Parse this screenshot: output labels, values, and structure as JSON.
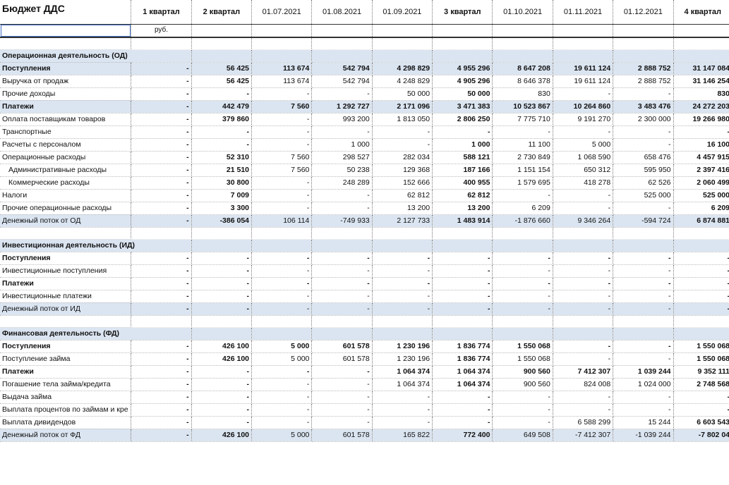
{
  "sheet": {
    "title": "Бюджет ДДС",
    "unit": "руб.",
    "columns": [
      "1 квартал",
      "2 квартал",
      "01.07.2021",
      "01.08.2021",
      "01.09.2021",
      "3 квартал",
      "01.10.2021",
      "01.11.2021",
      "01.12.2021",
      "4 квартал"
    ],
    "bold_columns": [
      0,
      1,
      5,
      9
    ]
  },
  "rows": [
    {
      "type": "blank"
    },
    {
      "type": "section",
      "label": "Операционная деятельность (ОД)"
    },
    {
      "type": "subtotal",
      "label": "Поступления",
      "values": [
        "-",
        "56 425",
        "113 674",
        "542 794",
        "4 298 829",
        "4 955 296",
        "8 647 208",
        "19 611 124",
        "2 888 752",
        "31 147 084"
      ]
    },
    {
      "type": "row",
      "label": "Выручка от продаж",
      "values": [
        "-",
        "56 425",
        "113 674",
        "542 794",
        "4 248 829",
        "4 905 296",
        "8 646 378",
        "19 611 124",
        "2 888 752",
        "31 146 254"
      ]
    },
    {
      "type": "row",
      "label": "Прочие доходы",
      "values": [
        "-",
        "-",
        "-",
        "-",
        "50 000",
        "50 000",
        "830",
        "-",
        "-",
        "830"
      ]
    },
    {
      "type": "subtotal",
      "label": "Платежи",
      "values": [
        "-",
        "442 479",
        "7 560",
        "1 292 727",
        "2 171 096",
        "3 471 383",
        "10 523 867",
        "10 264 860",
        "3 483 476",
        "24 272 203"
      ]
    },
    {
      "type": "row",
      "label": "Оплата поставщикам товаров",
      "values": [
        "-",
        "379 860",
        "-",
        "993 200",
        "1 813 050",
        "2 806 250",
        "7 775 710",
        "9 191 270",
        "2 300 000",
        "19 266 980"
      ]
    },
    {
      "type": "row",
      "label": "Транспортные",
      "values": [
        "-",
        "-",
        "-",
        "-",
        "-",
        "-",
        "-",
        "-",
        "-",
        "-"
      ]
    },
    {
      "type": "row",
      "label": "Расчеты с персоналом",
      "values": [
        "-",
        "-",
        "-",
        "1 000",
        "-",
        "1 000",
        "11 100",
        "5 000",
        "-",
        "16 100"
      ]
    },
    {
      "type": "row",
      "label": "Операционные расходы",
      "values": [
        "-",
        "52 310",
        "7 560",
        "298 527",
        "282 034",
        "588 121",
        "2 730 849",
        "1 068 590",
        "658 476",
        "4 457 915"
      ]
    },
    {
      "type": "row",
      "indent": true,
      "label": "Административные расходы",
      "values": [
        "-",
        "21 510",
        "7 560",
        "50 238",
        "129 368",
        "187 166",
        "1 151 154",
        "650 312",
        "595 950",
        "2 397 416"
      ]
    },
    {
      "type": "row",
      "indent": true,
      "label": "Коммерческие расходы",
      "values": [
        "-",
        "30 800",
        "-",
        "248 289",
        "152 666",
        "400 955",
        "1 579 695",
        "418 278",
        "62 526",
        "2 060 499"
      ]
    },
    {
      "type": "row",
      "label": "Налоги",
      "values": [
        "-",
        "7 009",
        "-",
        "-",
        "62 812",
        "62 812",
        "-",
        "-",
        "525 000",
        "525 000"
      ]
    },
    {
      "type": "row",
      "label": "Прочие операционные расходы",
      "values": [
        "-",
        "3 300",
        "-",
        "-",
        "13 200",
        "13 200",
        "6 209",
        "-",
        "-",
        "6 209"
      ]
    },
    {
      "type": "total",
      "label": "Денежный поток от ОД",
      "values": [
        "-",
        "-386 054",
        "106 114",
        "-749 933",
        "2 127 733",
        "1 483 914",
        "-1 876 660",
        "9 346 264",
        "-594 724",
        "6 874 881"
      ]
    },
    {
      "type": "blank"
    },
    {
      "type": "section",
      "label": "Инвестиционная деятельность (ИД)"
    },
    {
      "type": "bold",
      "label": "Поступления",
      "values": [
        "-",
        "-",
        "-",
        "-",
        "-",
        "-",
        "-",
        "-",
        "-",
        "-"
      ]
    },
    {
      "type": "row",
      "label": "Инвестиционные поступления",
      "values": [
        "-",
        "-",
        "-",
        "-",
        "-",
        "-",
        "-",
        "-",
        "-",
        "-"
      ]
    },
    {
      "type": "bold",
      "label": "Платежи",
      "values": [
        "-",
        "-",
        "-",
        "-",
        "-",
        "-",
        "-",
        "-",
        "-",
        "-"
      ]
    },
    {
      "type": "row",
      "label": "Инвестиционные платежи",
      "values": [
        "-",
        "-",
        "-",
        "-",
        "-",
        "-",
        "-",
        "-",
        "-",
        "-"
      ]
    },
    {
      "type": "total",
      "label": "Денежный поток от ИД",
      "values": [
        "-",
        "-",
        "-",
        "-",
        "-",
        "-",
        "-",
        "-",
        "-",
        "-"
      ]
    },
    {
      "type": "blank"
    },
    {
      "type": "section",
      "label": "Финансовая деятельность (ФД)"
    },
    {
      "type": "bold",
      "label": "Поступления",
      "values": [
        "-",
        "426 100",
        "5 000",
        "601 578",
        "1 230 196",
        "1 836 774",
        "1 550 068",
        "-",
        "-",
        "1 550 068"
      ]
    },
    {
      "type": "row",
      "label": "Поступление займа",
      "values": [
        "-",
        "426 100",
        "5 000",
        "601 578",
        "1 230 196",
        "1 836 774",
        "1 550 068",
        "-",
        "-",
        "1 550 068"
      ]
    },
    {
      "type": "bold",
      "label": "Платежи",
      "values": [
        "-",
        "-",
        "-",
        "-",
        "1 064 374",
        "1 064 374",
        "900 560",
        "7 412 307",
        "1 039 244",
        "9 352 111"
      ]
    },
    {
      "type": "row",
      "label": "Погашение тела займа/кредита",
      "values": [
        "-",
        "-",
        "-",
        "-",
        "1 064 374",
        "1 064 374",
        "900 560",
        "824 008",
        "1 024 000",
        "2 748 568"
      ]
    },
    {
      "type": "row",
      "label": "Выдача займа",
      "values": [
        "-",
        "-",
        "-",
        "-",
        "-",
        "-",
        "-",
        "-",
        "-",
        "-"
      ]
    },
    {
      "type": "row",
      "label": "Выплата процентов по займам и кре",
      "values": [
        "-",
        "-",
        "-",
        "-",
        "-",
        "-",
        "-",
        "-",
        "-",
        "-"
      ]
    },
    {
      "type": "row",
      "label": "Выплата дивидендов",
      "values": [
        "-",
        "-",
        "-",
        "-",
        "-",
        "-",
        "-",
        "6 588 299",
        "15 244",
        "6 603 543"
      ]
    },
    {
      "type": "total",
      "label": "Денежный поток от ФД",
      "values": [
        "-",
        "426 100",
        "5 000",
        "601 578",
        "165 822",
        "772 400",
        "649 508",
        "-7 412 307",
        "-1 039 244",
        "-7 802 04"
      ]
    }
  ]
}
